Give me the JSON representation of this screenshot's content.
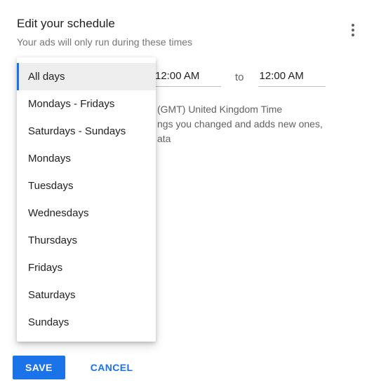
{
  "header": {
    "title": "Edit your schedule",
    "subtitle": "Your ads will only run during these times"
  },
  "schedule": {
    "start_time": "12:00 AM",
    "to_label": "to",
    "end_time": "12:00 AM"
  },
  "info": {
    "line1": "(GMT) United Kingdom Time",
    "line2": "ngs you changed and adds new ones,",
    "line3": "ata"
  },
  "dropdown": {
    "options": [
      "All days",
      "Mondays - Fridays",
      "Saturdays - Sundays",
      "Mondays",
      "Tuesdays",
      "Wednesdays",
      "Thursdays",
      "Fridays",
      "Saturdays",
      "Sundays"
    ],
    "selected_index": 0
  },
  "footer": {
    "save": "SAVE",
    "cancel": "CANCEL"
  }
}
